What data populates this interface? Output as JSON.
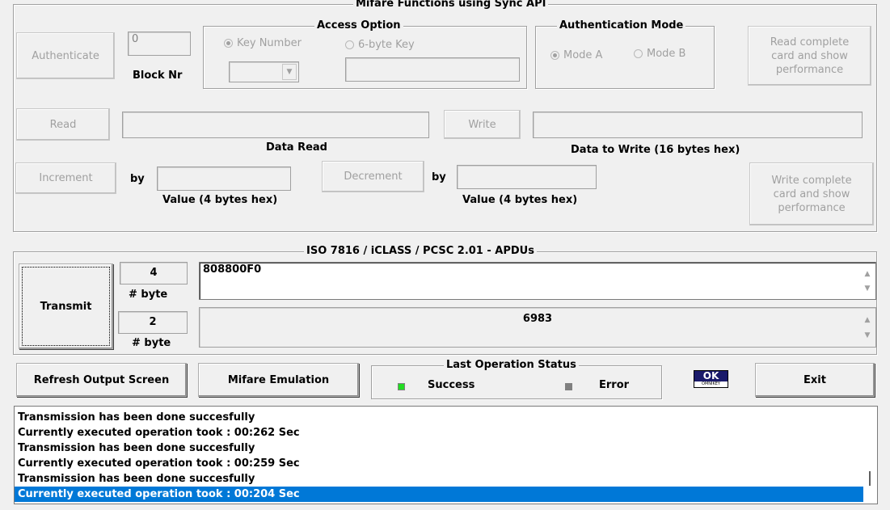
{
  "mifare": {
    "title": "Mifare Functions using Sync API",
    "authenticate_label": "Authenticate",
    "block_nr_value": "0",
    "block_nr_label": "Block Nr",
    "access_option": {
      "title": "Access Option",
      "key_number_label": "Key Number",
      "six_byte_key_label": "6-byte Key",
      "key_number_selected": true
    },
    "auth_mode": {
      "title": "Authentication Mode",
      "mode_a_label": "Mode A",
      "mode_b_label": "Mode B",
      "mode_a_selected": true
    },
    "read_complete_label": "Read complete card and show performance",
    "read_label": "Read",
    "data_read_label": "Data Read",
    "write_label": "Write",
    "data_to_write_label": "Data to Write (16 bytes hex)",
    "increment_label": "Increment",
    "by_label": "by",
    "inc_value_label": "Value (4 bytes hex)",
    "decrement_label": "Decrement",
    "dec_value_label": "Value (4 bytes hex)",
    "write_complete_label": "Write complete card and show performance"
  },
  "apdu": {
    "title": "ISO 7816  /  iCLASS  /  PCSC 2.01  - APDUs",
    "transmit_label": "Transmit",
    "send_bytes": "4",
    "send_bytes_label": "# byte",
    "send_data": "808800F0",
    "recv_bytes": "2",
    "recv_bytes_label": "# byte",
    "recv_data": "6983"
  },
  "controls": {
    "refresh_label": "Refresh Output Screen",
    "mifare_emulation_label": "Mifare Emulation",
    "status_title": "Last Operation Status",
    "success_label": "Success",
    "error_label": "Error",
    "success_color": "#22dd22",
    "error_color": "#808080",
    "exit_label": "Exit",
    "logo_text": "OK",
    "logo_sub": "OMNIKEY"
  },
  "log": [
    "Transmission has been done succesfully",
    "Currently executed operation took :  00:262 Sec",
    "Transmission has been done succesfully",
    "Currently executed operation took :  00:259 Sec",
    "Transmission has been done succesfully",
    "Currently executed operation took :  00:204 Sec"
  ],
  "accent_color": "#0078d7"
}
